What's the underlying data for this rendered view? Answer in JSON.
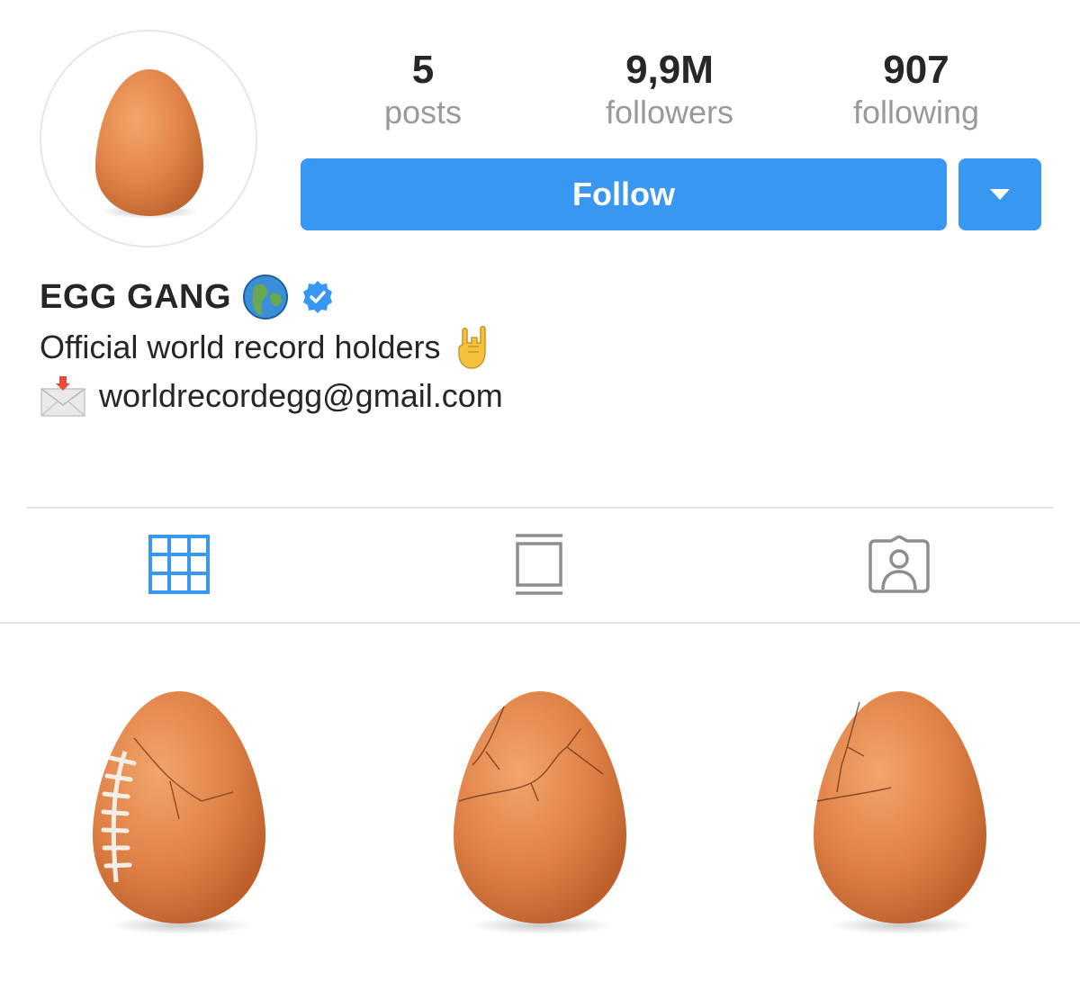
{
  "profile": {
    "username": "EGG GANG",
    "stats": [
      {
        "count": "5",
        "label": "posts"
      },
      {
        "count": "9,9M",
        "label": "followers"
      },
      {
        "count": "907",
        "label": "following"
      }
    ],
    "follow_label": "Follow",
    "bio": "Official world record holders",
    "email": "worldrecordegg@gmail.com"
  },
  "tabs": [
    {
      "name": "grid-view",
      "icon": "grid-icon",
      "active": true
    },
    {
      "name": "feed-view",
      "icon": "feed-icon",
      "active": false
    },
    {
      "name": "tagged-view",
      "icon": "tagged-person-icon",
      "active": false
    }
  ],
  "posts": [
    {
      "variant": "football-laced-egg"
    },
    {
      "variant": "cracked-egg"
    },
    {
      "variant": "cracked-egg"
    }
  ],
  "colors": {
    "accent": "#3897f0",
    "egg": "#e38a4a",
    "muted_text": "#999999",
    "icon_inactive": "#8e8e8e"
  }
}
